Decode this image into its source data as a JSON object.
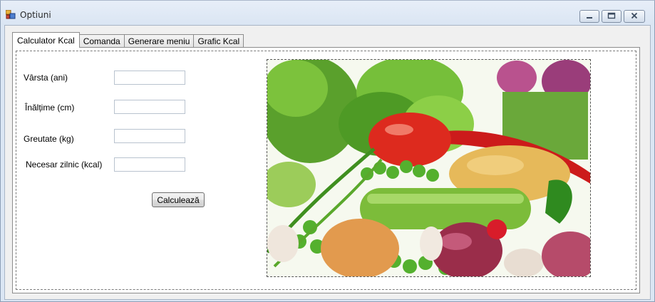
{
  "window": {
    "title": "Optiuni",
    "icons": {
      "app": "app-icon",
      "minimize": "minimize-icon",
      "maximize": "maximize-icon",
      "close": "close-icon"
    }
  },
  "tabs": [
    {
      "label": "Calculator Kcal",
      "active": true
    },
    {
      "label": "Comanda",
      "active": false
    },
    {
      "label": "Generare meniu",
      "active": false
    },
    {
      "label": "Grafic Kcal",
      "active": false
    }
  ],
  "form": {
    "age_label": "Vârsta (ani)",
    "height_label": "Înălțime (cm)",
    "weight_label": "Greutate (kg)",
    "need_label": "Necesar zilnic (kcal)",
    "age_value": "",
    "height_value": "",
    "weight_value": "",
    "need_value": "",
    "calculate_label": "Calculează"
  },
  "picture": {
    "subject": "vegetables-photo"
  },
  "colors": {
    "window_frame": "#dbe6f4",
    "client_bg": "#f0f0f0",
    "tab_page_bg": "#ffffff"
  }
}
